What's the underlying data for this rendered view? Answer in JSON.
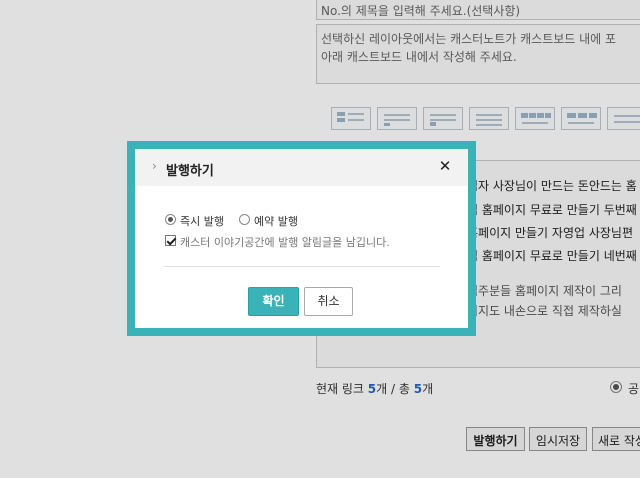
{
  "editor": {
    "title_placeholder": "No.의 제목을 입력해 주세요.(선택사항)",
    "desc_line1": "선택하신 레이아웃에서는 캐스터노트가 캐스트보드 내에 포",
    "desc_line2": "아래 캐스트보드 내에서 작성해 주세요.",
    "links": [
      "업자 사장님이 만드는 돈안드는 홈",
      "업 홈페이지 무료로 만들기 두번째",
      "홈페이지 만들기 자영업 사장님편",
      "업 홈페이지 무료로 만들기 네번째"
    ],
    "content_line1": "업주분들 홈페이지 제작이 그리",
    "content_line2": "이지도 내손으로 직접 제작하실",
    "link_count_prefix": "현재 링크 ",
    "link_count_current": "5",
    "link_count_sep": "개 / 총 ",
    "link_count_total": "5",
    "link_count_suffix": "개",
    "right_option_label": "공"
  },
  "bottom_buttons": {
    "publish": "발행하기",
    "save_temp": "임시저장",
    "new": "새로 작성"
  },
  "modal": {
    "title": "발행하기",
    "close_glyph": "✕",
    "options": {
      "immediate": "즉시 발행",
      "scheduled": "예약 발행",
      "selected": "immediate"
    },
    "notify_label": "캐스터 이야기공간에 발행 알림글을 남깁니다.",
    "notify_checked": true,
    "ok_label": "확인",
    "cancel_label": "취소"
  },
  "colors": {
    "accent": "#3ab3b8",
    "link_count": "#2a66c8"
  }
}
